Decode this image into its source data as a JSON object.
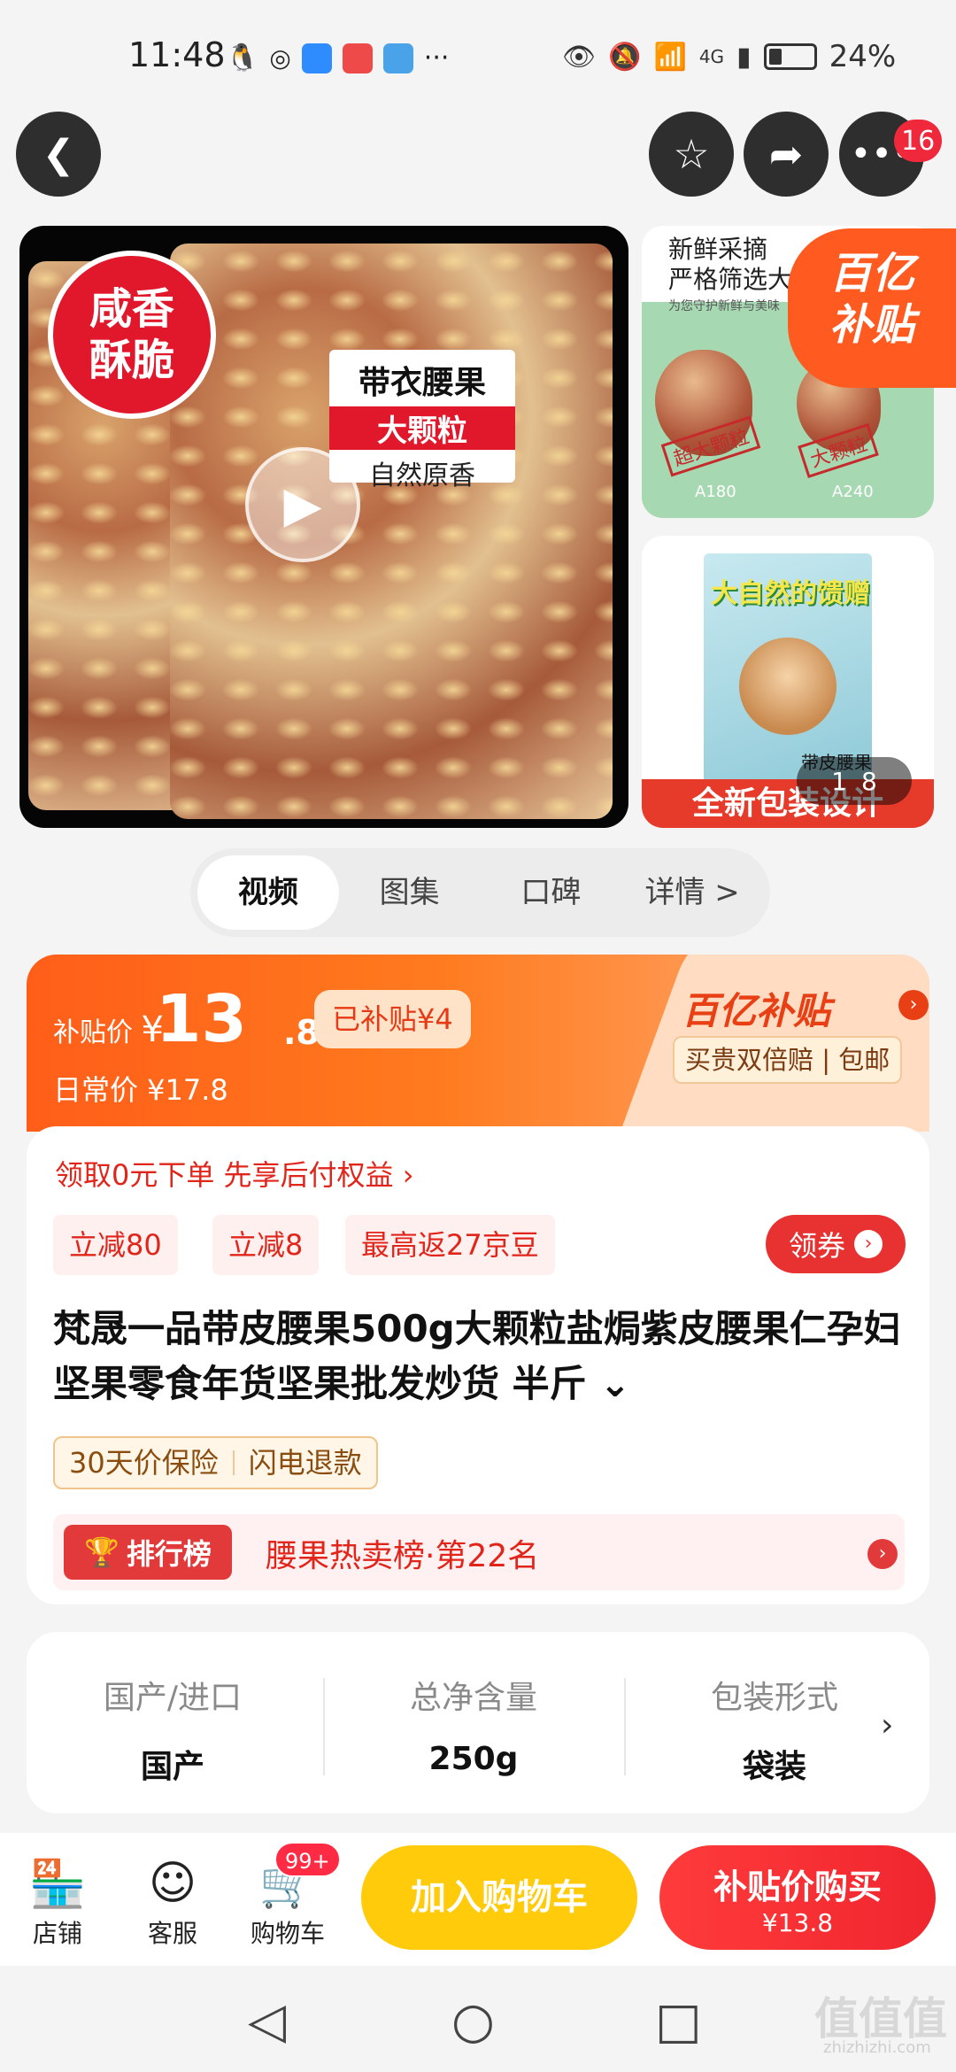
{
  "status_bar": {
    "time": "11:48",
    "more": "···",
    "network": "4G",
    "battery": "24%"
  },
  "nav": {
    "back_icon": "chevron-left-icon",
    "favorite_icon": "star-icon",
    "share_icon": "share-icon",
    "more_icon": "more-dots-icon",
    "more_badge": "16"
  },
  "gallery": {
    "main_badge_line1": "咸香",
    "main_badge_line2": "酥脆",
    "label_line1": "带衣腰果",
    "label_line2": "大颗粒",
    "label_line3": "自然原香",
    "thumb1_text_line1": "新鲜采摘",
    "thumb1_text_line2": "严格筛选大",
    "thumb1_sub": "为您守护新鲜与美味",
    "thumb1_stamp1": "超大颗粒",
    "thumb1_stamp2": "大颗粒",
    "thumb1_cap1": "A180",
    "thumb1_cap2": "A240",
    "subsidy_line1": "百亿",
    "subsidy_line2": "补贴",
    "thumb2_pkg_title": "大自然的馈赠",
    "thumb2_pkg_name": "带皮腰果",
    "thumb2_band": "全新包装设计",
    "counter_current": "1",
    "counter_total": "8"
  },
  "tabs": [
    "视频",
    "图集",
    "口碑",
    "详情 >"
  ],
  "price": {
    "label": "补贴价",
    "currency": "¥",
    "integer": "13",
    "decimal": ".8",
    "subsidy_pill": "已补贴¥4",
    "daily": "日常价 ¥17.8",
    "brand": "百亿补贴",
    "guarantee": "买贵双倍赔 | 包邮"
  },
  "promo": {
    "link": "领取0元下单 先享后付权益 ›",
    "coupons": [
      "立减80",
      "立减8",
      "最高返27京豆"
    ],
    "get_coupon": "领券"
  },
  "product": {
    "title": "梵晟一品带皮腰果500g大颗粒盐焗紫皮腰果仁孕妇坚果零食年货坚果批发炒货 半斤 ⌄",
    "tags": [
      "30天价保险",
      "闪电退款"
    ],
    "rank_badge": "排行榜",
    "rank_text": "腰果热卖榜·第22名"
  },
  "specs": [
    {
      "k": "国产/进口",
      "v": "国产"
    },
    {
      "k": "总净含量",
      "v": "250g"
    },
    {
      "k": "包装形式",
      "v": "袋装"
    }
  ],
  "bottom": {
    "store": "店铺",
    "service": "客服",
    "cart": "购物车",
    "cart_badge": "99+",
    "add_cart": "加入购物车",
    "buy_line1": "补贴价购买",
    "buy_line2": "¥13.8"
  },
  "watermark": {
    "main": "值值值",
    "sub": "zhizhizhi.com"
  },
  "colors": {
    "accent": "#e1251b",
    "orange": "#ff5e19",
    "yellow": "#ffcb0b"
  }
}
